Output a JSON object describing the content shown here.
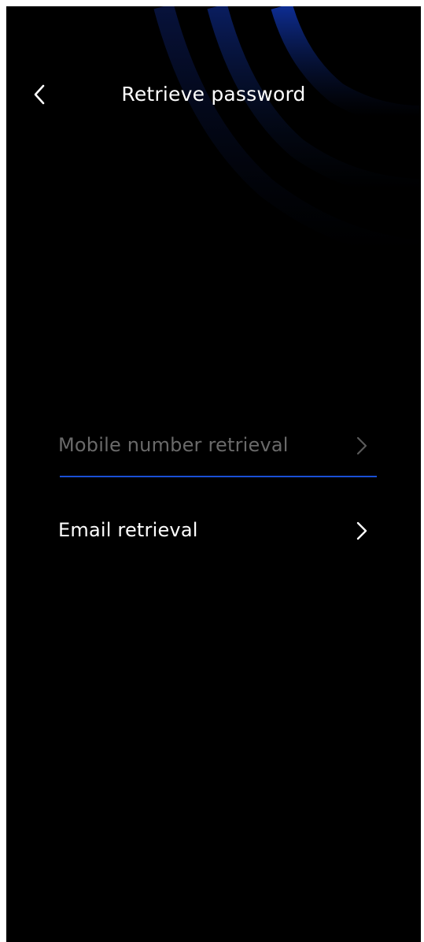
{
  "header": {
    "back_icon": "chevron-left-icon",
    "title": "Retrieve password"
  },
  "options": [
    {
      "label": "Mobile number retrieval",
      "icon": "chevron-right-icon",
      "active": true
    },
    {
      "label": "Email retrieval",
      "icon": "chevron-right-icon",
      "active": false
    }
  ],
  "colors": {
    "background": "#000000",
    "accent": "#1a4fd6",
    "text_primary": "#ffffff",
    "text_muted": "#6a6a6a",
    "decor_blue": "#0f2d8c"
  }
}
